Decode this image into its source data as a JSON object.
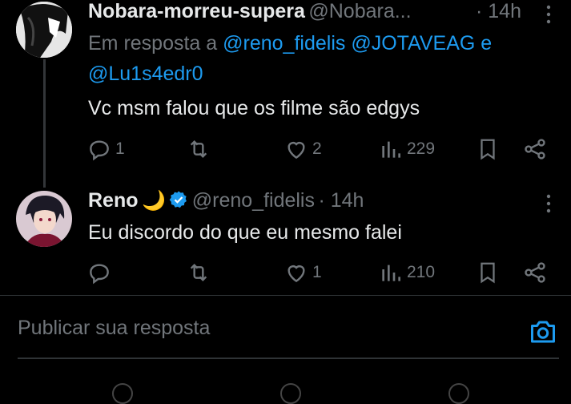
{
  "tweet1": {
    "display_name": "Nobara-morreu-supera",
    "handle": "@Nobara...",
    "time": "· 14h",
    "reply_prefix": "Em resposta a",
    "reply_to_line1": "@reno_fidelis @JOTAVEAG e",
    "reply_to_line2": "@Lu1s4edr0",
    "text": "Vc msm falou que os filme são edgys",
    "replies": "1",
    "retweets": "",
    "likes": "2",
    "views": "229"
  },
  "tweet2": {
    "display_name": "Reno",
    "emoji": "🌙",
    "handle": "@reno_fidelis",
    "time": "· 14h",
    "text": "Eu discordo do que eu mesmo falei",
    "replies": "",
    "retweets": "",
    "likes": "1",
    "views": "210"
  },
  "composer": {
    "placeholder": "Publicar sua resposta"
  },
  "colors": {
    "accent": "#1d9bf0",
    "muted": "#71767b",
    "background": "#000000",
    "text": "#e7e9ea"
  },
  "icons": [
    "reply-icon",
    "retweet-icon",
    "like-icon",
    "views-icon",
    "bookmark-icon",
    "share-icon",
    "more-icon",
    "verified-icon",
    "camera-icon"
  ]
}
